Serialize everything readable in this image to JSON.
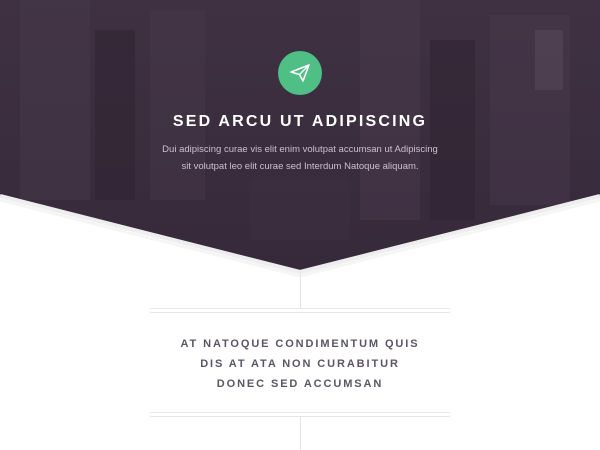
{
  "hero": {
    "icon": "paper-plane-icon",
    "title": "SED ARCU UT ADIPISCING",
    "subtitle_lines": [
      "Dui adipiscing curae vis elit enim volutpat accumsan ut Adipiscing",
      "sit volutpat leo elit curae sed Interdum Natoque aliquam."
    ]
  },
  "features": {
    "items": [
      "AT NATOQUE CONDIMENTUM QUIS",
      "DIS AT ATA NON CURABITUR",
      "DONEC SED ACCUMSAN"
    ]
  },
  "colors": {
    "hero_bg": "#3a2d3d",
    "accent": "#4fbf85",
    "subtitle": "#cbbfd0",
    "feature_text": "#5d5563"
  }
}
